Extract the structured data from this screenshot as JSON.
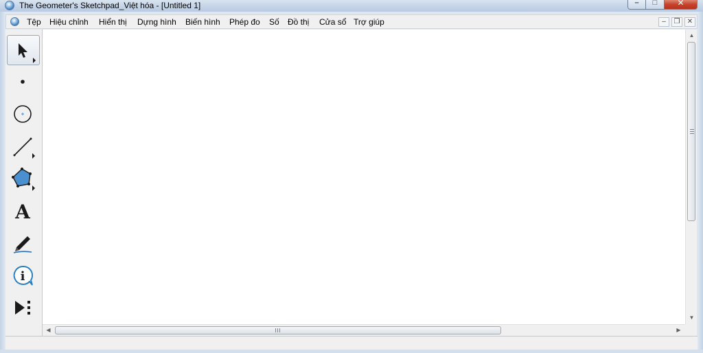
{
  "window": {
    "title": "The Geometer's Sketchpad_Việt hóa - [Untitled 1]",
    "controls": {
      "minimize": "–",
      "maximize": "□",
      "close": "✕"
    }
  },
  "menubar": {
    "items": [
      "Tệp",
      "Hiệu chỉnh",
      "Hiển thị",
      "Dựng hình",
      "Biến hình",
      "Phép đo",
      "Số",
      "Đồ thị",
      "Cửa sổ",
      "Trợ giúp"
    ],
    "mdi_controls": {
      "minimize": "–",
      "restore": "❐",
      "close": "✕"
    }
  },
  "toolbox": {
    "tools": [
      {
        "name": "arrow-select-tool",
        "icon": "arrow-icon",
        "active": true
      },
      {
        "name": "point-tool",
        "icon": "point-icon",
        "active": false
      },
      {
        "name": "compass-tool",
        "icon": "circle-icon",
        "active": false
      },
      {
        "name": "straightedge-tool",
        "icon": "segment-icon",
        "active": false
      },
      {
        "name": "polygon-tool",
        "icon": "polygon-icon",
        "active": false
      },
      {
        "name": "text-tool",
        "icon": "text-icon",
        "active": false
      },
      {
        "name": "marker-tool",
        "icon": "marker-icon",
        "active": false
      },
      {
        "name": "information-tool",
        "icon": "info-icon",
        "active": false
      },
      {
        "name": "custom-tool",
        "icon": "custom-tools-icon",
        "active": false
      }
    ],
    "text_tool_glyph": "A",
    "info_tool_glyph": "i"
  },
  "scrollbars": {
    "up": "▲",
    "down": "▼",
    "left": "◀",
    "right": "▶"
  },
  "colors": {
    "polygon_fill": "#4a90d0",
    "compass_center": "#4a90d0",
    "info_ring": "#2a7fc1",
    "marker_stroke": "#2a6fb5"
  }
}
